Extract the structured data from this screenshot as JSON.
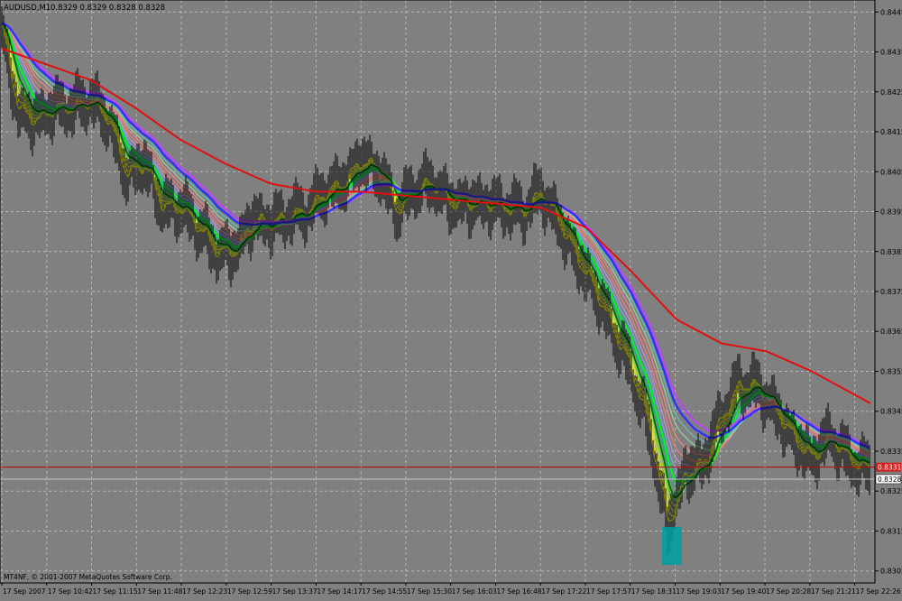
{
  "header": {
    "symbol_text": "AUDUSD,M1",
    "ohlc_text": "0.8329 0.8329 0.8328 0.8328"
  },
  "footer": {
    "copyright": "MT4NF, © 2001-2007 MetaQuotes Software Corp."
  },
  "colors": {
    "background": "#808080",
    "grid": "#b8b8b8",
    "candle": "#000000",
    "ema_slow": "#e01010",
    "ema_fast_band": "#ffff00",
    "ema_top": "#3030ff",
    "ema_top2": "#c040ff",
    "hline": "#c00000",
    "price_tag_bid": "#d02020",
    "price_tag_last": "#ffffff",
    "highlight_box": "#00a0a0"
  },
  "price_tags": {
    "bid": "0.8331",
    "last": "0.8328"
  },
  "chart_data": {
    "type": "line",
    "title": "AUDUSD,M1",
    "xlabel": "",
    "ylabel": "",
    "ylim": [
      0.8302,
      0.8448
    ],
    "y_ticks": [
      "0.8445",
      "0.8435",
      "0.8425",
      "0.8415",
      "0.8405",
      "0.8395",
      "0.8385",
      "0.8375",
      "0.8365",
      "0.8355",
      "0.8345",
      "0.8335",
      "0.8325",
      "0.8315",
      "0.8305"
    ],
    "x_ticks": [
      "17 Sep 2007",
      "17 Sep 10:42",
      "17 Sep 11:15",
      "17 Sep 11:48",
      "17 Sep 12:23",
      "17 Sep 12:59",
      "17 Sep 13:37",
      "17 Sep 14:17",
      "17 Sep 14:55",
      "17 Sep 15:30",
      "17 Sep 16:03",
      "17 Sep 16:48",
      "17 Sep 17:22",
      "17 Sep 17:57",
      "17 Sep 18:31",
      "17 Sep 19:03",
      "17 Sep 19:40",
      "17 Sep 20:28",
      "17 Sep 21:21",
      "17 Sep 22:26"
    ],
    "grid": true,
    "horizontal_line": 0.8331,
    "series": [
      {
        "role": "price",
        "x": [
          0,
          20,
          40,
          60,
          80,
          100,
          120,
          140,
          160,
          180,
          200,
          220,
          240,
          260,
          280,
          300,
          320,
          340,
          360,
          380,
          400,
          420,
          440,
          460,
          480,
          500,
          520,
          540,
          560,
          580,
          600,
          620,
          640,
          660,
          680,
          700,
          720,
          740,
          760,
          780,
          800,
          820,
          840,
          860,
          880,
          900,
          920,
          940,
          965
        ],
        "values": [
          0.8442,
          0.842,
          0.8418,
          0.8421,
          0.8421,
          0.8423,
          0.8418,
          0.8404,
          0.8407,
          0.8396,
          0.8396,
          0.8391,
          0.8385,
          0.8385,
          0.8393,
          0.8392,
          0.8394,
          0.8395,
          0.84,
          0.8402,
          0.8408,
          0.8405,
          0.8395,
          0.8401,
          0.8402,
          0.8397,
          0.8397,
          0.8397,
          0.8396,
          0.8395,
          0.84,
          0.8392,
          0.8383,
          0.8375,
          0.8365,
          0.8355,
          0.834,
          0.8316,
          0.833,
          0.8332,
          0.8344,
          0.8352,
          0.8351,
          0.8345,
          0.8338,
          0.8333,
          0.8339,
          0.8333,
          0.833
        ]
      },
      {
        "role": "ema_slow",
        "x": [
          0,
          50,
          100,
          150,
          200,
          250,
          300,
          350,
          400,
          450,
          500,
          550,
          600,
          650,
          700,
          750,
          800,
          850,
          900,
          965
        ],
        "values": [
          0.8436,
          0.8432,
          0.8428,
          0.8421,
          0.8413,
          0.8407,
          0.8402,
          0.84,
          0.84,
          0.8399,
          0.8398,
          0.8397,
          0.8396,
          0.8391,
          0.838,
          0.8368,
          0.8362,
          0.836,
          0.8355,
          0.8347
        ]
      }
    ]
  }
}
